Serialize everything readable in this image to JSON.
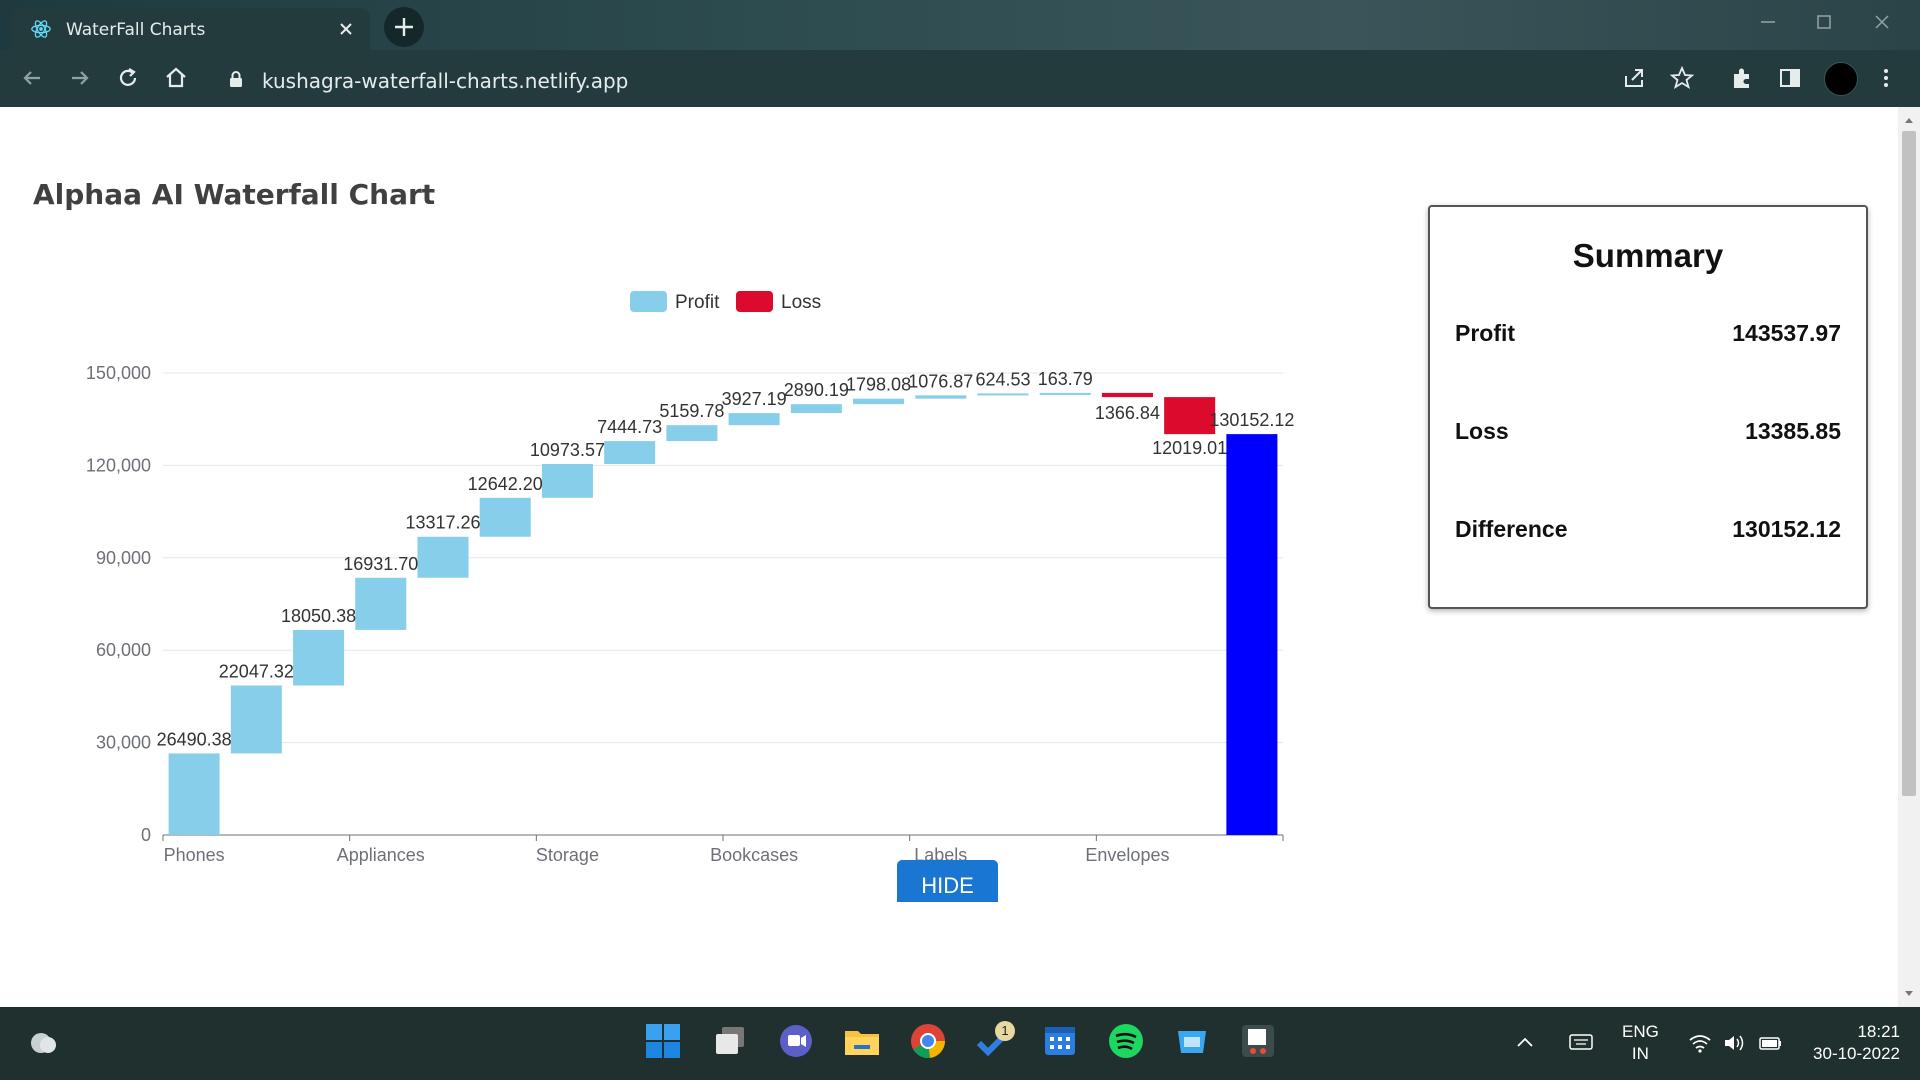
{
  "browser": {
    "tab_title": "WaterFall Charts",
    "url": "kushagra-waterfall-charts.netlify.app"
  },
  "chart_data": {
    "type": "bar",
    "title": "Alphaa AI Waterfall Chart",
    "legend": [
      {
        "name": "Profit",
        "color": "#87ceeb"
      },
      {
        "name": "Loss",
        "color": "#dc0a2d"
      }
    ],
    "legend_position": "top",
    "xlabel": "",
    "ylabel": "",
    "ylim": [
      0,
      150000
    ],
    "yticks": [
      0,
      30000,
      60000,
      90000,
      120000,
      150000
    ],
    "ytick_labels": [
      "0",
      "30,000",
      "60,000",
      "90,000",
      "120,000",
      "150,000"
    ],
    "x_tick_labels": [
      "Phones",
      "Appliances",
      "Storage",
      "Bookcases",
      "Labels",
      "Envelopes"
    ],
    "grid": true,
    "steps": [
      {
        "value": 26490.38,
        "type": "profit",
        "label": "26490.38"
      },
      {
        "value": 22047.32,
        "type": "profit",
        "label": "22047.32"
      },
      {
        "value": 18050.38,
        "type": "profit",
        "label": "18050.38"
      },
      {
        "value": 16931.7,
        "type": "profit",
        "label": "16931.70"
      },
      {
        "value": 13317.26,
        "type": "profit",
        "label": "13317.26"
      },
      {
        "value": 12642.2,
        "type": "profit",
        "label": "12642.20"
      },
      {
        "value": 10973.57,
        "type": "profit",
        "label": "10973.57"
      },
      {
        "value": 7444.73,
        "type": "profit",
        "label": "7444.73"
      },
      {
        "value": 5159.78,
        "type": "profit",
        "label": "5159.78"
      },
      {
        "value": 3927.19,
        "type": "profit",
        "label": "3927.19"
      },
      {
        "value": 2890.19,
        "type": "profit",
        "label": "2890.19"
      },
      {
        "value": 1798.08,
        "type": "profit",
        "label": "1798.08"
      },
      {
        "value": 1076.87,
        "type": "profit",
        "label": "1076.87"
      },
      {
        "value": 624.53,
        "type": "profit",
        "label": "624.53"
      },
      {
        "value": 163.79,
        "type": "profit",
        "label": "163.79"
      },
      {
        "value": 1366.84,
        "type": "loss",
        "label": "1366.84"
      },
      {
        "value": 12019.01,
        "type": "loss",
        "label": "12019.01"
      },
      {
        "value": 130152.12,
        "type": "total",
        "label": "130152.12"
      }
    ],
    "colors": {
      "profit": "#87ceeb",
      "loss": "#dc0a2d",
      "total": "#0000ff"
    }
  },
  "summary": {
    "title": "Summary",
    "rows": [
      {
        "label": "Profit",
        "value": "143537.97"
      },
      {
        "label": "Loss",
        "value": "13385.85"
      },
      {
        "label": "Difference",
        "value": "130152.12"
      }
    ]
  },
  "hide_button": {
    "label": "HIDE"
  },
  "taskbar": {
    "lang_line1": "ENG",
    "lang_line2": "IN",
    "time": "18:21",
    "date": "30-10-2022",
    "todo_badge": "1",
    "apps": [
      "windows-start",
      "task-view",
      "teams-chat",
      "file-explorer",
      "chrome",
      "todo",
      "calendar",
      "spotify",
      "store",
      "snipping-tool"
    ]
  }
}
